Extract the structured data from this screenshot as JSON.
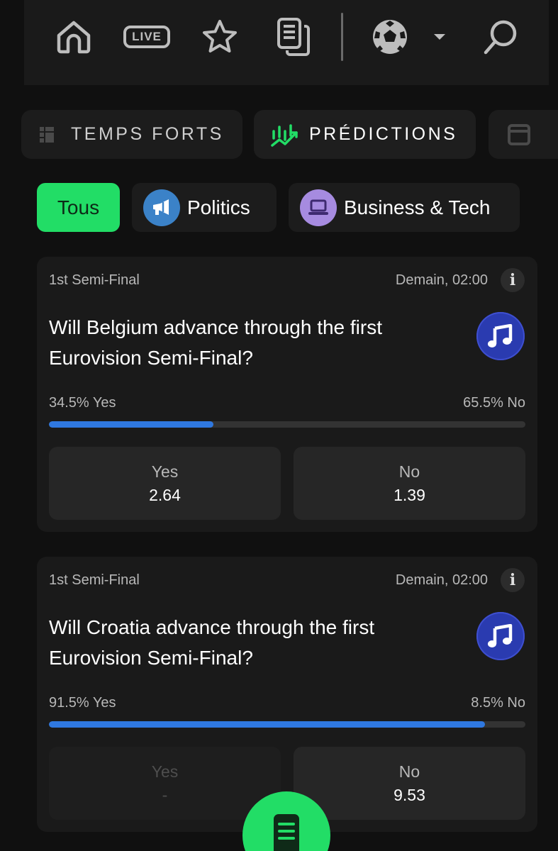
{
  "nav": {
    "icons": [
      "home-icon",
      "live-icon",
      "star-icon",
      "documents-icon",
      "soccer-ball-icon",
      "caret-down-icon",
      "search-icon"
    ],
    "live_label": "LIVE"
  },
  "sections": [
    {
      "label": "TEMPS FORTS",
      "icon": "highlights-icon"
    },
    {
      "label": "PRÉDICTIONS",
      "icon": "trending-chart-icon"
    },
    {
      "label": "",
      "icon": "calendar-icon"
    }
  ],
  "filters": [
    {
      "label": "Tous",
      "active": true
    },
    {
      "label": "Politics",
      "icon": "megaphone-icon"
    },
    {
      "label": "Business & Tech",
      "icon": "laptop-icon"
    }
  ],
  "colors": {
    "accent": "#22dd66",
    "progress": "#2f78e0",
    "music_badge": "#2a3bb0"
  },
  "cards": [
    {
      "category": "1st Semi-Final",
      "time": "Demain, 02:00",
      "info_label": "i",
      "question": "Will Belgium advance through the first Eurovision Semi-Final?",
      "icon": "music-note-icon",
      "yes_pct_label": "34.5% Yes",
      "no_pct_label": "65.5% No",
      "yes_fraction": 0.345,
      "yes": {
        "label": "Yes",
        "odds": "2.64"
      },
      "no": {
        "label": "No",
        "odds": "1.39"
      }
    },
    {
      "category": "1st Semi-Final",
      "time": "Demain, 02:00",
      "info_label": "i",
      "question": "Will Croatia advance through the first Eurovision Semi-Final?",
      "icon": "music-note-icon",
      "yes_pct_label": "91.5% Yes",
      "no_pct_label": "8.5% No",
      "yes_fraction": 0.915,
      "yes": {
        "label": "Yes",
        "odds": "-"
      },
      "no": {
        "label": "No",
        "odds": "9.53"
      }
    }
  ],
  "fab": {
    "icon": "betslip-icon"
  }
}
